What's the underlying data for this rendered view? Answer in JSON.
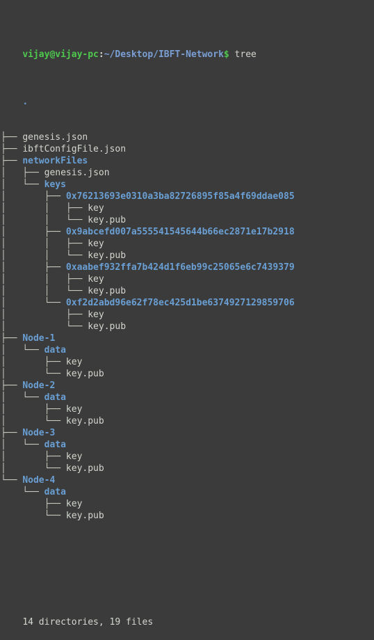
{
  "terminal": {
    "background_color": "#3b3b3b",
    "dir_color": "#6a9fd4",
    "file_color": "#d3d7cf",
    "prompt_color": "#4ec94e",
    "path_color": "#7a9fd4"
  },
  "prompt": {
    "user_host": "vijay@vijay-pc",
    "separator": ":",
    "path": "~/Desktop/IBFT-Network",
    "sigil": "$",
    "command": " tree"
  },
  "tree": {
    "root": ".",
    "lines": [
      {
        "branch": "├── ",
        "name": "genesis.json",
        "kind": "file"
      },
      {
        "branch": "├── ",
        "name": "ibftConfigFile.json",
        "kind": "file"
      },
      {
        "branch": "├── ",
        "name": "networkFiles",
        "kind": "dir"
      },
      {
        "branch": "│   ├── ",
        "name": "genesis.json",
        "kind": "file"
      },
      {
        "branch": "│   └── ",
        "name": "keys",
        "kind": "dir"
      },
      {
        "branch": "│       ├── ",
        "name": "0x76213693e0310a3ba82726895f85a4f69ddae085",
        "kind": "dir"
      },
      {
        "branch": "│       │   ├── ",
        "name": "key",
        "kind": "file"
      },
      {
        "branch": "│       │   └── ",
        "name": "key.pub",
        "kind": "file"
      },
      {
        "branch": "│       ├── ",
        "name": "0x9abcefd007a555541545644b66ec2871e17b2918",
        "kind": "dir"
      },
      {
        "branch": "│       │   ├── ",
        "name": "key",
        "kind": "file"
      },
      {
        "branch": "│       │   └── ",
        "name": "key.pub",
        "kind": "file"
      },
      {
        "branch": "│       ├── ",
        "name": "0xaabef932ffa7b424d1f6eb99c25065e6c7439379",
        "kind": "dir"
      },
      {
        "branch": "│       │   ├── ",
        "name": "key",
        "kind": "file"
      },
      {
        "branch": "│       │   └── ",
        "name": "key.pub",
        "kind": "file"
      },
      {
        "branch": "│       └── ",
        "name": "0xf2d2abd96e62f78ec425d1be6374927129859706",
        "kind": "dir"
      },
      {
        "branch": "│           ├── ",
        "name": "key",
        "kind": "file"
      },
      {
        "branch": "│           └── ",
        "name": "key.pub",
        "kind": "file"
      },
      {
        "branch": "├── ",
        "name": "Node-1",
        "kind": "dir"
      },
      {
        "branch": "│   └── ",
        "name": "data",
        "kind": "dir"
      },
      {
        "branch": "│       ├── ",
        "name": "key",
        "kind": "file"
      },
      {
        "branch": "│       └── ",
        "name": "key.pub",
        "kind": "file"
      },
      {
        "branch": "├── ",
        "name": "Node-2",
        "kind": "dir"
      },
      {
        "branch": "│   └── ",
        "name": "data",
        "kind": "dir"
      },
      {
        "branch": "│       ├── ",
        "name": "key",
        "kind": "file"
      },
      {
        "branch": "│       └── ",
        "name": "key.pub",
        "kind": "file"
      },
      {
        "branch": "├── ",
        "name": "Node-3",
        "kind": "dir"
      },
      {
        "branch": "│   └── ",
        "name": "data",
        "kind": "dir"
      },
      {
        "branch": "│       ├── ",
        "name": "key",
        "kind": "file"
      },
      {
        "branch": "│       └── ",
        "name": "key.pub",
        "kind": "file"
      },
      {
        "branch": "└── ",
        "name": "Node-4",
        "kind": "dir"
      },
      {
        "branch": "    └── ",
        "name": "data",
        "kind": "dir"
      },
      {
        "branch": "        ├── ",
        "name": "key",
        "kind": "file"
      },
      {
        "branch": "        └── ",
        "name": "key.pub",
        "kind": "file"
      }
    ]
  },
  "summary": "14 directories, 19 files"
}
